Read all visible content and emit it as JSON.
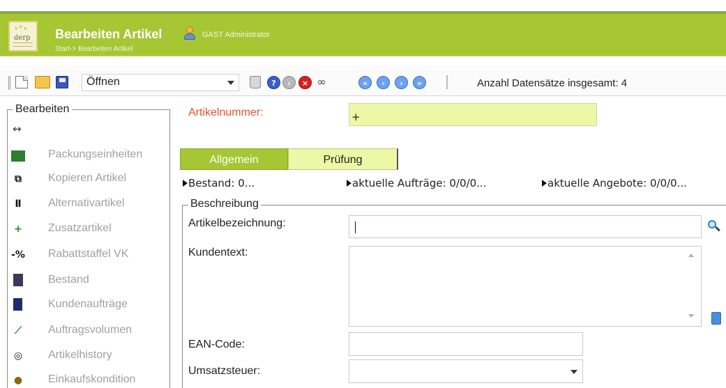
{
  "header": {
    "logo_text": "derp",
    "title": "Bearbeiten Artikel",
    "user": "GAST Administrator",
    "breadcrumb": "Start-> Bearbeiten Artikel",
    "bg_color": "#a6c634"
  },
  "toolbar": {
    "icons": [
      "new-document-icon",
      "open-folder-icon",
      "save-disk-icon",
      "trash-icon",
      "help-icon",
      "back-icon",
      "cancel-icon",
      "binoculars-icon",
      "first-record-icon",
      "previous-record-icon",
      "next-record-icon",
      "last-record-icon"
    ],
    "action_select": "Öffnen",
    "record_count": "Anzahl Datensätze insgesamt: 4"
  },
  "sidebar": {
    "legend": "Bearbeiten",
    "toggle_glyph": "↔",
    "items": [
      {
        "label": "Packungseinheiten",
        "icon": "package-units-icon"
      },
      {
        "label": "Kopieren Artikel",
        "icon": "copy-article-icon"
      },
      {
        "label": "Alternativartikel",
        "icon": "alternative-article-icon"
      },
      {
        "label": "Zusatzartikel",
        "icon": "additional-article-icon"
      },
      {
        "label": "Rabattstaffel VK",
        "icon": "discount-scale-icon"
      },
      {
        "label": "Bestand",
        "icon": "stock-icon"
      },
      {
        "label": "Kundenaufträge",
        "icon": "customer-orders-icon"
      },
      {
        "label": "Auftragsvolumen",
        "icon": "order-volume-chart-icon"
      },
      {
        "label": "Artikelhistory",
        "icon": "article-history-icon"
      },
      {
        "label": "Einkaufskondition",
        "icon": "purchase-condition-icon"
      }
    ]
  },
  "article": {
    "number_label": "Artikelnummer:",
    "number_value": "+",
    "label_color": "#e2552b",
    "input_color": "#ecf8a6"
  },
  "tabs": [
    {
      "label": "Allgemein",
      "active": true
    },
    {
      "label": "Prüfung",
      "active": false
    }
  ],
  "status": {
    "bestand": "Bestand: 0...",
    "auftraege": "aktuelle Aufträge: 0/0/0...",
    "angebote": "aktuelle Angebote: 0/0/0..."
  },
  "beschreibung": {
    "legend": "Beschreibung",
    "artikelbezeichnung_label": "Artikelbezeichnung:",
    "artikelbezeichnung_value": "",
    "kundentext_label": "Kundentext:",
    "kundentext_value": "",
    "ean_label": "EAN-Code:",
    "ean_value": "",
    "umsatzsteuer_label": "Umsatzsteuer:",
    "umsatzsteuer_value": ""
  }
}
